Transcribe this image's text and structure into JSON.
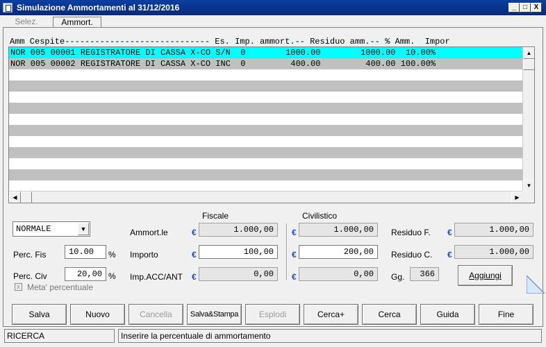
{
  "window": {
    "title": "Simulazione Ammortamenti al 31/12/2016",
    "btn_min": "_",
    "btn_max": "□",
    "btn_close": "X"
  },
  "tabs": [
    {
      "label": "Selez."
    },
    {
      "label": "Ammort."
    }
  ],
  "list": {
    "header": "Amm Cespite----------------------------- Es. Imp. ammort.-- Residuo amm.-- % Amm.  Impor",
    "rows": [
      "NOR 005 00001 REGISTRATORE DI CASSA X-CO S/N  0        1000.00        1000.00  10.00%",
      "NOR 005 00002 REGISTRATORE DI CASSA X-CO INC  0         400.00         400.00 100.00%"
    ],
    "selected_color": "#00ffff",
    "stripe_color": "#c0c0c0"
  },
  "form": {
    "section_fiscale": "Fiscale",
    "section_civilistico": "Civilistico",
    "mode_select": "NORMALE",
    "perc_fis_label": "Perc. Fis",
    "perc_fis_value": "10.00",
    "perc_civ_label": "Perc. Civ",
    "perc_civ_value": "20,00",
    "percent_sign": "%",
    "meta_label": "Meta' percentuale",
    "ammortle_label": "Ammort.le",
    "importo_label": "Importo",
    "impacc_label": "Imp.ACC/ANT",
    "euro": "€",
    "fis_ammortle": "1.000,00",
    "fis_importo": "100,00",
    "fis_impacc": "0,00",
    "civ_ammortle": "1.000,00",
    "civ_importo": "200,00",
    "civ_impacc": "0,00",
    "residuo_f_label": "Residuo F.",
    "residuo_f_value": "1.000,00",
    "residuo_c_label": "Residuo C.",
    "residuo_c_value": "1.000,00",
    "gg_label": "Gg.",
    "gg_value": "366",
    "aggiungi_label": "Aggiungi"
  },
  "buttons": {
    "salva": "Salva",
    "nuovo": "Nuovo",
    "cancella": "Cancella",
    "salva_stampa": "Salva&Stampa",
    "esplodi": "Esplodi",
    "cerca_plus": "Cerca+",
    "cerca": "Cerca",
    "guida": "Guida",
    "fine": "Fine"
  },
  "status": {
    "mode": "RICERCA",
    "message": "Inserire la percentuale di ammortamento"
  }
}
